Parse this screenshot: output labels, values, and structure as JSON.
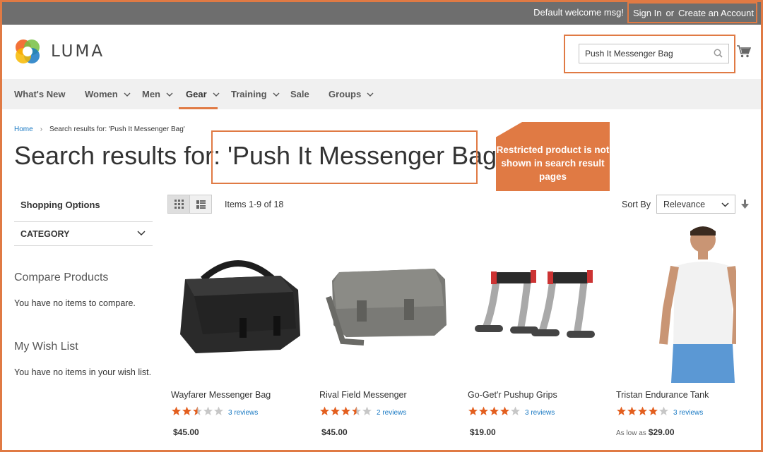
{
  "topbar": {
    "welcome": "Default welcome msg!",
    "sign_in": "Sign In",
    "or": "or",
    "create_account": "Create an Account"
  },
  "logo": {
    "text": "LUMA"
  },
  "search": {
    "value": "Push It Messenger Bag"
  },
  "nav": {
    "items": [
      {
        "label": "What's New"
      },
      {
        "label": "Women"
      },
      {
        "label": "Men"
      },
      {
        "label": "Gear"
      },
      {
        "label": "Training"
      },
      {
        "label": "Sale"
      },
      {
        "label": "Groups"
      }
    ],
    "active": "Gear"
  },
  "breadcrumb": {
    "home": "Home",
    "current": "Search results for: 'Push It Messenger Bag'"
  },
  "page": {
    "title_prefix": "Search results for: ",
    "title_query": "'Push It Messenger Bag'"
  },
  "callout": {
    "text": "Restricted product is not shown in search result pages"
  },
  "sidebar": {
    "shopping_options": "Shopping Options",
    "category": "CATEGORY",
    "compare_title": "Compare Products",
    "compare_text": "You have no items to compare.",
    "wishlist_title": "My Wish List",
    "wishlist_text": "You have no items in your wish list."
  },
  "toolbar": {
    "items_count": "Items 1-9 of 18",
    "sort_by_label": "Sort By",
    "sort_value": "Relevance"
  },
  "products": [
    {
      "name": "Wayfarer Messenger Bag",
      "rating": 2.5,
      "reviews": "3 reviews",
      "price_prefix": "",
      "price": "$45.00"
    },
    {
      "name": "Rival Field Messenger",
      "rating": 3.5,
      "reviews": "2 reviews",
      "price_prefix": "",
      "price": "$45.00"
    },
    {
      "name": "Go-Get'r Pushup Grips",
      "rating": 4,
      "reviews": "3 reviews",
      "price_prefix": "",
      "price": "$19.00"
    },
    {
      "name": "Tristan Endurance Tank",
      "rating": 4,
      "reviews": "3 reviews",
      "price_prefix": "As low as",
      "price": "$29.00"
    }
  ],
  "colors": {
    "accent": "#e07a44",
    "link": "#1979c3",
    "star": "#e35f1f",
    "star_empty": "#c7c7c7"
  }
}
